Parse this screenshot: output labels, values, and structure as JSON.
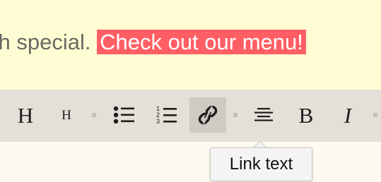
{
  "editor": {
    "text_before_link": "ch special.",
    "link_text": "Check out our menu!"
  },
  "toolbar": {
    "heading1_label": "H",
    "heading2_label": "H",
    "bullet_list_icon": "unordered-list-icon",
    "numbered_list_icon": "ordered-list-icon",
    "link_icon": "link-icon",
    "align_center_icon": "align-center-icon",
    "bold_label": "B",
    "italic_label": "I",
    "active_button": "link"
  },
  "tooltip": {
    "text": "Link text"
  },
  "colors": {
    "text_area_bg": "#fdfcd3",
    "highlight_bg": "#ff5f64",
    "toolbar_bg": "#e4e0d8",
    "active_button_bg": "#cfcbc3"
  }
}
